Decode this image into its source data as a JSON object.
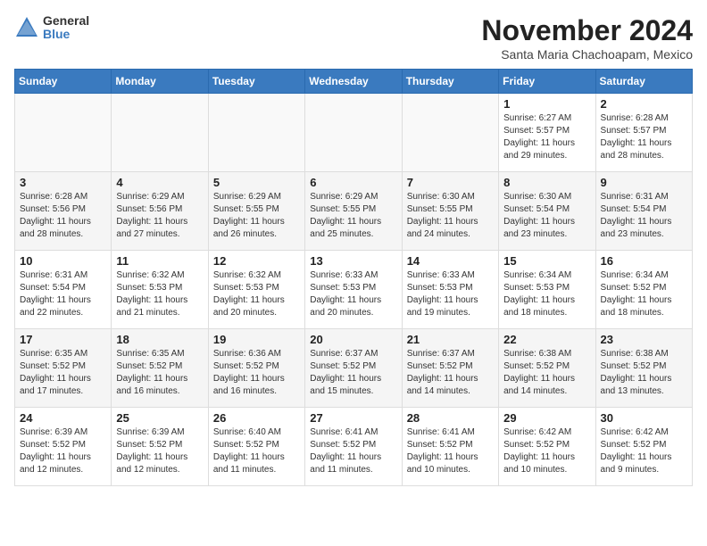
{
  "logo": {
    "general": "General",
    "blue": "Blue"
  },
  "title": "November 2024",
  "location": "Santa Maria Chachoapam, Mexico",
  "weekdays": [
    "Sunday",
    "Monday",
    "Tuesday",
    "Wednesday",
    "Thursday",
    "Friday",
    "Saturday"
  ],
  "weeks": [
    [
      {
        "day": "",
        "info": ""
      },
      {
        "day": "",
        "info": ""
      },
      {
        "day": "",
        "info": ""
      },
      {
        "day": "",
        "info": ""
      },
      {
        "day": "",
        "info": ""
      },
      {
        "day": "1",
        "info": "Sunrise: 6:27 AM\nSunset: 5:57 PM\nDaylight: 11 hours\nand 29 minutes."
      },
      {
        "day": "2",
        "info": "Sunrise: 6:28 AM\nSunset: 5:57 PM\nDaylight: 11 hours\nand 28 minutes."
      }
    ],
    [
      {
        "day": "3",
        "info": "Sunrise: 6:28 AM\nSunset: 5:56 PM\nDaylight: 11 hours\nand 28 minutes."
      },
      {
        "day": "4",
        "info": "Sunrise: 6:29 AM\nSunset: 5:56 PM\nDaylight: 11 hours\nand 27 minutes."
      },
      {
        "day": "5",
        "info": "Sunrise: 6:29 AM\nSunset: 5:55 PM\nDaylight: 11 hours\nand 26 minutes."
      },
      {
        "day": "6",
        "info": "Sunrise: 6:29 AM\nSunset: 5:55 PM\nDaylight: 11 hours\nand 25 minutes."
      },
      {
        "day": "7",
        "info": "Sunrise: 6:30 AM\nSunset: 5:55 PM\nDaylight: 11 hours\nand 24 minutes."
      },
      {
        "day": "8",
        "info": "Sunrise: 6:30 AM\nSunset: 5:54 PM\nDaylight: 11 hours\nand 23 minutes."
      },
      {
        "day": "9",
        "info": "Sunrise: 6:31 AM\nSunset: 5:54 PM\nDaylight: 11 hours\nand 23 minutes."
      }
    ],
    [
      {
        "day": "10",
        "info": "Sunrise: 6:31 AM\nSunset: 5:54 PM\nDaylight: 11 hours\nand 22 minutes."
      },
      {
        "day": "11",
        "info": "Sunrise: 6:32 AM\nSunset: 5:53 PM\nDaylight: 11 hours\nand 21 minutes."
      },
      {
        "day": "12",
        "info": "Sunrise: 6:32 AM\nSunset: 5:53 PM\nDaylight: 11 hours\nand 20 minutes."
      },
      {
        "day": "13",
        "info": "Sunrise: 6:33 AM\nSunset: 5:53 PM\nDaylight: 11 hours\nand 20 minutes."
      },
      {
        "day": "14",
        "info": "Sunrise: 6:33 AM\nSunset: 5:53 PM\nDaylight: 11 hours\nand 19 minutes."
      },
      {
        "day": "15",
        "info": "Sunrise: 6:34 AM\nSunset: 5:53 PM\nDaylight: 11 hours\nand 18 minutes."
      },
      {
        "day": "16",
        "info": "Sunrise: 6:34 AM\nSunset: 5:52 PM\nDaylight: 11 hours\nand 18 minutes."
      }
    ],
    [
      {
        "day": "17",
        "info": "Sunrise: 6:35 AM\nSunset: 5:52 PM\nDaylight: 11 hours\nand 17 minutes."
      },
      {
        "day": "18",
        "info": "Sunrise: 6:35 AM\nSunset: 5:52 PM\nDaylight: 11 hours\nand 16 minutes."
      },
      {
        "day": "19",
        "info": "Sunrise: 6:36 AM\nSunset: 5:52 PM\nDaylight: 11 hours\nand 16 minutes."
      },
      {
        "day": "20",
        "info": "Sunrise: 6:37 AM\nSunset: 5:52 PM\nDaylight: 11 hours\nand 15 minutes."
      },
      {
        "day": "21",
        "info": "Sunrise: 6:37 AM\nSunset: 5:52 PM\nDaylight: 11 hours\nand 14 minutes."
      },
      {
        "day": "22",
        "info": "Sunrise: 6:38 AM\nSunset: 5:52 PM\nDaylight: 11 hours\nand 14 minutes."
      },
      {
        "day": "23",
        "info": "Sunrise: 6:38 AM\nSunset: 5:52 PM\nDaylight: 11 hours\nand 13 minutes."
      }
    ],
    [
      {
        "day": "24",
        "info": "Sunrise: 6:39 AM\nSunset: 5:52 PM\nDaylight: 11 hours\nand 12 minutes."
      },
      {
        "day": "25",
        "info": "Sunrise: 6:39 AM\nSunset: 5:52 PM\nDaylight: 11 hours\nand 12 minutes."
      },
      {
        "day": "26",
        "info": "Sunrise: 6:40 AM\nSunset: 5:52 PM\nDaylight: 11 hours\nand 11 minutes."
      },
      {
        "day": "27",
        "info": "Sunrise: 6:41 AM\nSunset: 5:52 PM\nDaylight: 11 hours\nand 11 minutes."
      },
      {
        "day": "28",
        "info": "Sunrise: 6:41 AM\nSunset: 5:52 PM\nDaylight: 11 hours\nand 10 minutes."
      },
      {
        "day": "29",
        "info": "Sunrise: 6:42 AM\nSunset: 5:52 PM\nDaylight: 11 hours\nand 10 minutes."
      },
      {
        "day": "30",
        "info": "Sunrise: 6:42 AM\nSunset: 5:52 PM\nDaylight: 11 hours\nand 9 minutes."
      }
    ]
  ]
}
